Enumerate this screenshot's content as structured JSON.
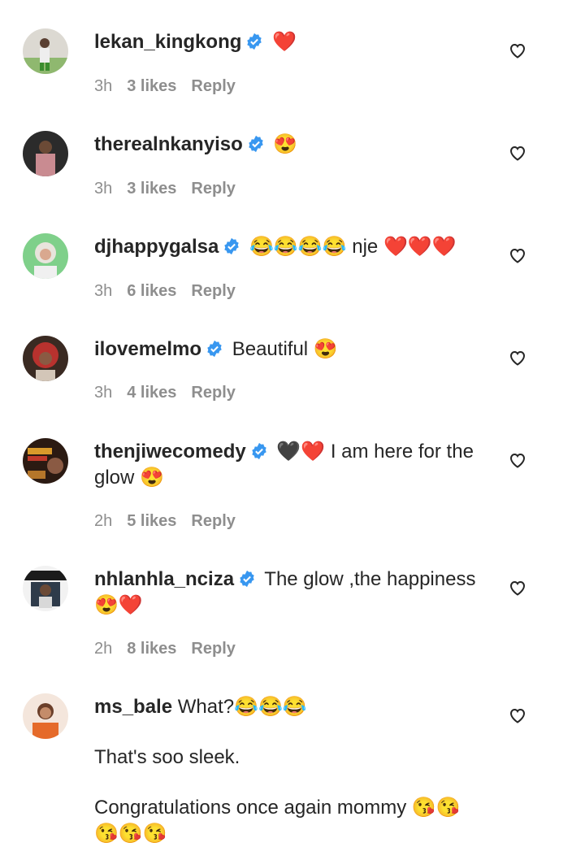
{
  "comments": [
    {
      "user": "lekan_kingkong",
      "text": "❤️",
      "time": "3h",
      "likes": "3 likes",
      "reply": "Reply"
    },
    {
      "user": "therealnkanyiso",
      "text": "😍",
      "time": "3h",
      "likes": "3 likes",
      "reply": "Reply"
    },
    {
      "user": "djhappygalsa",
      "text": "😂😂😂😂 nje ❤️❤️❤️",
      "time": "3h",
      "likes": "6 likes",
      "reply": "Reply"
    },
    {
      "user": "ilovemelmo",
      "text": "Beautiful 😍",
      "time": "3h",
      "likes": "4 likes",
      "reply": "Reply"
    },
    {
      "user": "thenjiwecomedy",
      "text": "🖤❤️ I am here for the glow 😍",
      "time": "2h",
      "likes": "5 likes",
      "reply": "Reply"
    },
    {
      "user": "nhlanhla_nciza",
      "text": "The glow ,the happiness 😍❤️",
      "time": "2h",
      "likes": "8 likes",
      "reply": "Reply"
    },
    {
      "user": "ms_bale",
      "text": "What?😂😂😂",
      "text2": "That's soo sleek.",
      "text3": "Congratulations once again mommy 😘😘😘😘😘"
    }
  ],
  "colors": {
    "username": "#262626",
    "meta": "#8e8e8e",
    "verified": "#3897f0"
  },
  "icons": {
    "verified": "verified-badge-icon",
    "like": "heart-outline-icon"
  }
}
